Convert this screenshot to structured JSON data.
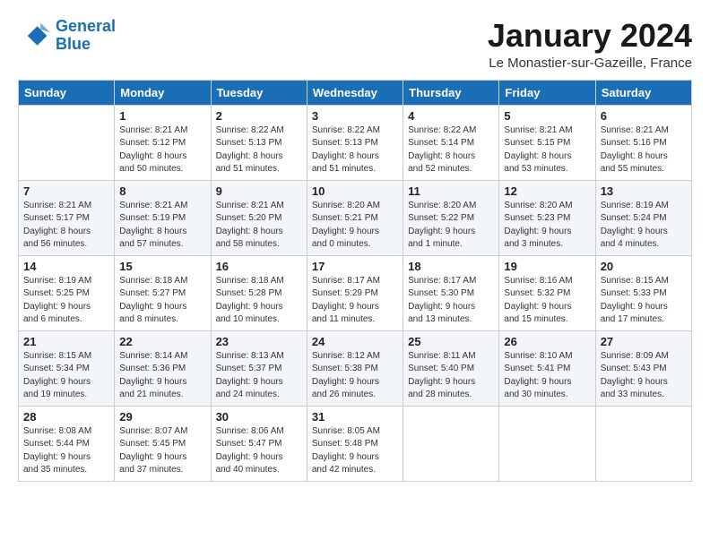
{
  "logo": {
    "line1": "General",
    "line2": "Blue"
  },
  "title": "January 2024",
  "subtitle": "Le Monastier-sur-Gazeille, France",
  "weekdays": [
    "Sunday",
    "Monday",
    "Tuesday",
    "Wednesday",
    "Thursday",
    "Friday",
    "Saturday"
  ],
  "weeks": [
    [
      {
        "day": "",
        "info": ""
      },
      {
        "day": "1",
        "info": "Sunrise: 8:21 AM\nSunset: 5:12 PM\nDaylight: 8 hours\nand 50 minutes."
      },
      {
        "day": "2",
        "info": "Sunrise: 8:22 AM\nSunset: 5:13 PM\nDaylight: 8 hours\nand 51 minutes."
      },
      {
        "day": "3",
        "info": "Sunrise: 8:22 AM\nSunset: 5:13 PM\nDaylight: 8 hours\nand 51 minutes."
      },
      {
        "day": "4",
        "info": "Sunrise: 8:22 AM\nSunset: 5:14 PM\nDaylight: 8 hours\nand 52 minutes."
      },
      {
        "day": "5",
        "info": "Sunrise: 8:21 AM\nSunset: 5:15 PM\nDaylight: 8 hours\nand 53 minutes."
      },
      {
        "day": "6",
        "info": "Sunrise: 8:21 AM\nSunset: 5:16 PM\nDaylight: 8 hours\nand 55 minutes."
      }
    ],
    [
      {
        "day": "7",
        "info": "Sunrise: 8:21 AM\nSunset: 5:17 PM\nDaylight: 8 hours\nand 56 minutes."
      },
      {
        "day": "8",
        "info": "Sunrise: 8:21 AM\nSunset: 5:19 PM\nDaylight: 8 hours\nand 57 minutes."
      },
      {
        "day": "9",
        "info": "Sunrise: 8:21 AM\nSunset: 5:20 PM\nDaylight: 8 hours\nand 58 minutes."
      },
      {
        "day": "10",
        "info": "Sunrise: 8:20 AM\nSunset: 5:21 PM\nDaylight: 9 hours\nand 0 minutes."
      },
      {
        "day": "11",
        "info": "Sunrise: 8:20 AM\nSunset: 5:22 PM\nDaylight: 9 hours\nand 1 minute."
      },
      {
        "day": "12",
        "info": "Sunrise: 8:20 AM\nSunset: 5:23 PM\nDaylight: 9 hours\nand 3 minutes."
      },
      {
        "day": "13",
        "info": "Sunrise: 8:19 AM\nSunset: 5:24 PM\nDaylight: 9 hours\nand 4 minutes."
      }
    ],
    [
      {
        "day": "14",
        "info": "Sunrise: 8:19 AM\nSunset: 5:25 PM\nDaylight: 9 hours\nand 6 minutes."
      },
      {
        "day": "15",
        "info": "Sunrise: 8:18 AM\nSunset: 5:27 PM\nDaylight: 9 hours\nand 8 minutes."
      },
      {
        "day": "16",
        "info": "Sunrise: 8:18 AM\nSunset: 5:28 PM\nDaylight: 9 hours\nand 10 minutes."
      },
      {
        "day": "17",
        "info": "Sunrise: 8:17 AM\nSunset: 5:29 PM\nDaylight: 9 hours\nand 11 minutes."
      },
      {
        "day": "18",
        "info": "Sunrise: 8:17 AM\nSunset: 5:30 PM\nDaylight: 9 hours\nand 13 minutes."
      },
      {
        "day": "19",
        "info": "Sunrise: 8:16 AM\nSunset: 5:32 PM\nDaylight: 9 hours\nand 15 minutes."
      },
      {
        "day": "20",
        "info": "Sunrise: 8:15 AM\nSunset: 5:33 PM\nDaylight: 9 hours\nand 17 minutes."
      }
    ],
    [
      {
        "day": "21",
        "info": "Sunrise: 8:15 AM\nSunset: 5:34 PM\nDaylight: 9 hours\nand 19 minutes."
      },
      {
        "day": "22",
        "info": "Sunrise: 8:14 AM\nSunset: 5:36 PM\nDaylight: 9 hours\nand 21 minutes."
      },
      {
        "day": "23",
        "info": "Sunrise: 8:13 AM\nSunset: 5:37 PM\nDaylight: 9 hours\nand 24 minutes."
      },
      {
        "day": "24",
        "info": "Sunrise: 8:12 AM\nSunset: 5:38 PM\nDaylight: 9 hours\nand 26 minutes."
      },
      {
        "day": "25",
        "info": "Sunrise: 8:11 AM\nSunset: 5:40 PM\nDaylight: 9 hours\nand 28 minutes."
      },
      {
        "day": "26",
        "info": "Sunrise: 8:10 AM\nSunset: 5:41 PM\nDaylight: 9 hours\nand 30 minutes."
      },
      {
        "day": "27",
        "info": "Sunrise: 8:09 AM\nSunset: 5:43 PM\nDaylight: 9 hours\nand 33 minutes."
      }
    ],
    [
      {
        "day": "28",
        "info": "Sunrise: 8:08 AM\nSunset: 5:44 PM\nDaylight: 9 hours\nand 35 minutes."
      },
      {
        "day": "29",
        "info": "Sunrise: 8:07 AM\nSunset: 5:45 PM\nDaylight: 9 hours\nand 37 minutes."
      },
      {
        "day": "30",
        "info": "Sunrise: 8:06 AM\nSunset: 5:47 PM\nDaylight: 9 hours\nand 40 minutes."
      },
      {
        "day": "31",
        "info": "Sunrise: 8:05 AM\nSunset: 5:48 PM\nDaylight: 9 hours\nand 42 minutes."
      },
      {
        "day": "",
        "info": ""
      },
      {
        "day": "",
        "info": ""
      },
      {
        "day": "",
        "info": ""
      }
    ]
  ]
}
